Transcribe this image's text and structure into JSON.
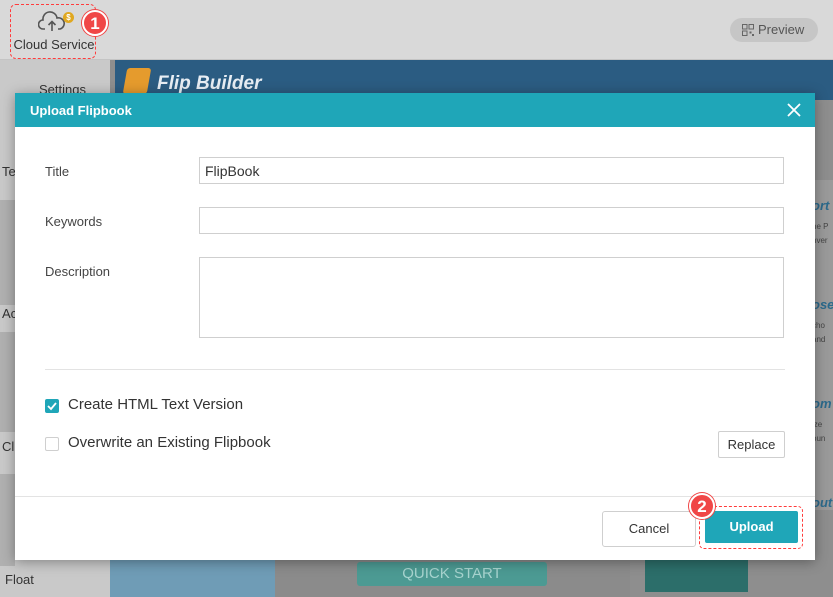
{
  "toolbar": {
    "cloud_service_label": "Cloud Service",
    "cloud_badge": "$",
    "preview_label": "Preview"
  },
  "steps": {
    "one": "1",
    "two": "2"
  },
  "sidebar": {
    "settings_label": "Settings",
    "fragments": [
      "Te",
      "Ac",
      "Cl"
    ],
    "float_label": "Float"
  },
  "canvas": {
    "brand": "Flip Builder",
    "quick_start": "QUICK START",
    "right_fragments": [
      "ort",
      "he P",
      "nver",
      "ose",
      "cho",
      "and",
      "om",
      "ize",
      "oun",
      "out",
      "flip",
      "K, P"
    ]
  },
  "modal": {
    "title": "Upload Flipbook",
    "title_label": "Title",
    "title_value": "FlipBook",
    "keywords_label": "Keywords",
    "keywords_value": "",
    "description_label": "Description",
    "description_value": "",
    "html_text_label": "Create HTML Text Version",
    "html_text_checked": true,
    "overwrite_label": "Overwrite an Existing Flipbook",
    "overwrite_checked": false,
    "replace_label": "Replace",
    "cancel_label": "Cancel",
    "upload_label": "Upload"
  },
  "colors": {
    "accent": "#1fa6b8",
    "highlight": "#ff3b3b",
    "brand_bar": "#2b5c82"
  }
}
